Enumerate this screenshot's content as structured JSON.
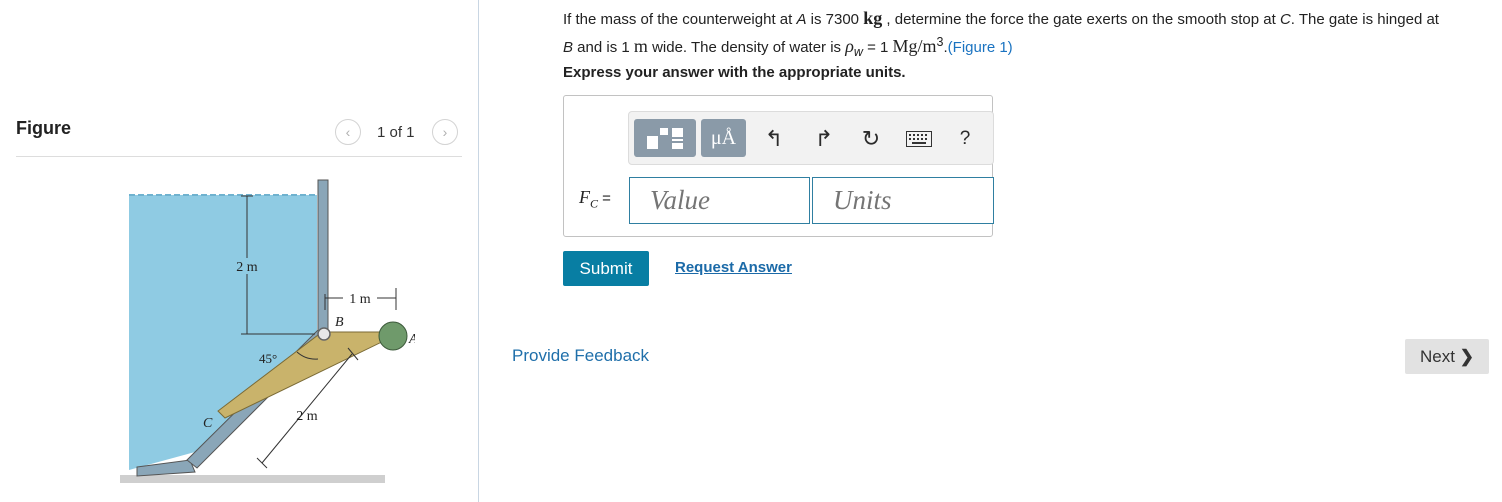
{
  "question": {
    "p1": "If the mass of the counterweight at ",
    "A": "A",
    "p2": " is 7300 ",
    "kg": "kg",
    "p3": " , determine the force the gate exerts on the smooth stop at ",
    "C": "C",
    "p4": ". The gate is hinged at ",
    "B": "B",
    "p5": " and is 1 ",
    "m": "m",
    "p6": " wide. The density of water is ",
    "rho": "ρ",
    "w": "w",
    "p7": " = 1 ",
    "unit": "Mg/m",
    "exp": "3",
    "p8": ".",
    "figure_link": "(Figure 1)"
  },
  "instruction": "Express your answer with the appropriate units.",
  "toolbar": {
    "units_glyph": "μÅ",
    "undo_icon": "↰",
    "redo_icon": "↱",
    "reset_icon": "↻",
    "help": "?"
  },
  "answer": {
    "label_main": "F",
    "label_sub": "C",
    "label_eq": " =",
    "value_placeholder": "Value",
    "units_placeholder": "Units"
  },
  "buttons": {
    "submit": "Submit",
    "request": "Request Answer",
    "feedback": "Provide Feedback",
    "next": "Next"
  },
  "figure": {
    "title": "Figure",
    "pager": "1 of 1",
    "prev_icon": "‹",
    "next_icon": "›",
    "labels": {
      "depth": "2 m",
      "arm": "1 m",
      "hinge": "B",
      "weight": "A",
      "angle": "45°",
      "stop": "C",
      "gate_length": "2 m"
    }
  },
  "colors": {
    "water": "#8fcbe3",
    "gate": "#8aa6b8",
    "brace": "#c9b36b",
    "weight": "#6f9a6b",
    "submit": "#087ea3",
    "link": "#1a73c1"
  }
}
